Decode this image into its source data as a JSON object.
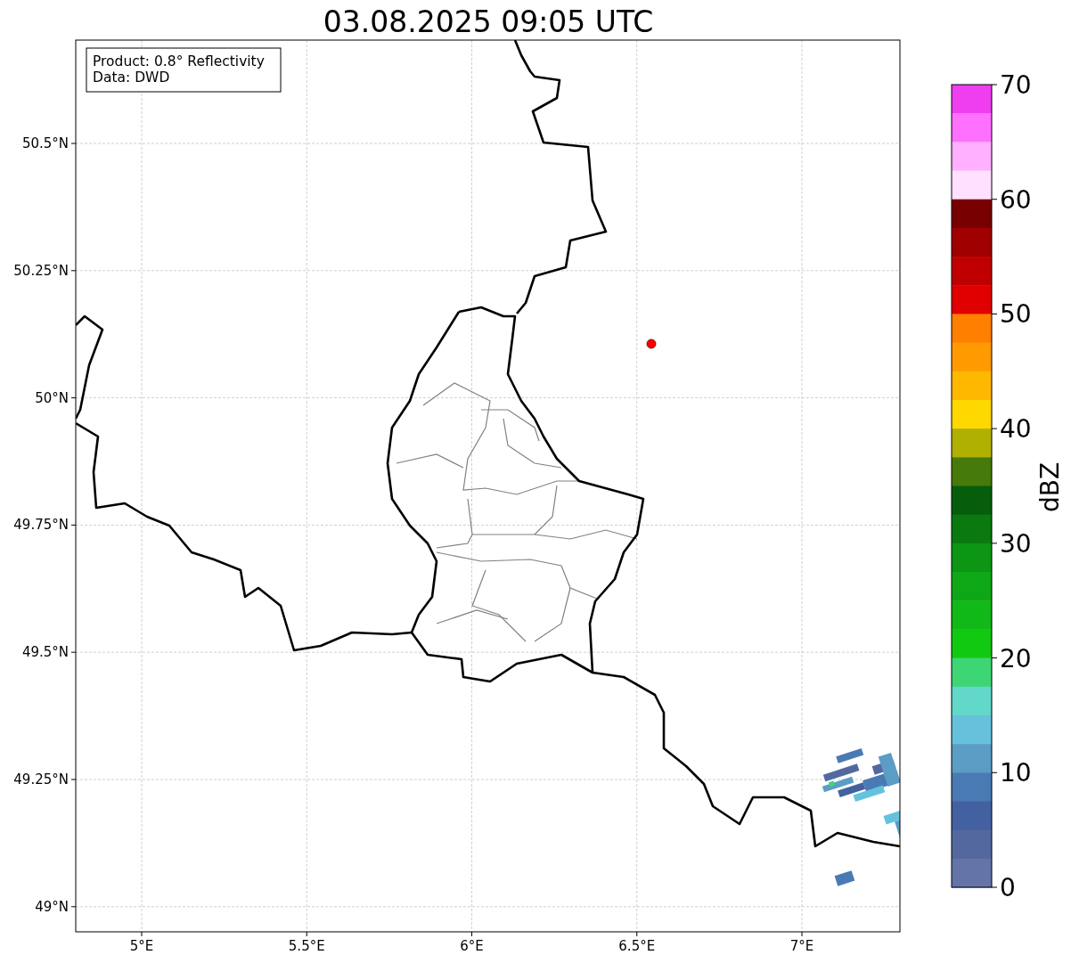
{
  "title": "03.08.2025 09:05 UTC",
  "info_box": [
    "Product: 0.8° Reflectivity",
    "Data: DWD"
  ],
  "map": {
    "xticks": [
      "5°E",
      "5.5°E",
      "6°E",
      "6.5°E",
      "7°E"
    ],
    "yticks": [
      "50.5°N",
      "50.25°N",
      "50°N",
      "49.75°N",
      "49.5°N",
      "49.25°N",
      "49°N"
    ]
  },
  "colorbar": {
    "label": "dBZ",
    "ticks": [
      "70",
      "60",
      "50",
      "40",
      "30",
      "20",
      "10",
      "0"
    ],
    "bands": [
      {
        "color": "#ee3ef0"
      },
      {
        "color": "#ff70ff"
      },
      {
        "color": "#ffb0ff"
      },
      {
        "color": "#ffe0ff"
      },
      {
        "color": "#780000"
      },
      {
        "color": "#a00000"
      },
      {
        "color": "#c00000"
      },
      {
        "color": "#e00000"
      },
      {
        "color": "#ff7f00"
      },
      {
        "color": "#ff9b00"
      },
      {
        "color": "#ffb800"
      },
      {
        "color": "#ffd800"
      },
      {
        "color": "#b0b000"
      },
      {
        "color": "#467a0a"
      },
      {
        "color": "#065e0c"
      },
      {
        "color": "#0a7a10"
      },
      {
        "color": "#0c9614"
      },
      {
        "color": "#0ea816"
      },
      {
        "color": "#10b818"
      },
      {
        "color": "#12c912"
      },
      {
        "color": "#3ed675"
      },
      {
        "color": "#62d8c8"
      },
      {
        "color": "#66c2dc"
      },
      {
        "color": "#5b9dc4"
      },
      {
        "color": "#4a7ab3"
      },
      {
        "color": "#4360a0"
      },
      {
        "color": "#5468a0"
      },
      {
        "color": "#6474a8"
      }
    ]
  }
}
